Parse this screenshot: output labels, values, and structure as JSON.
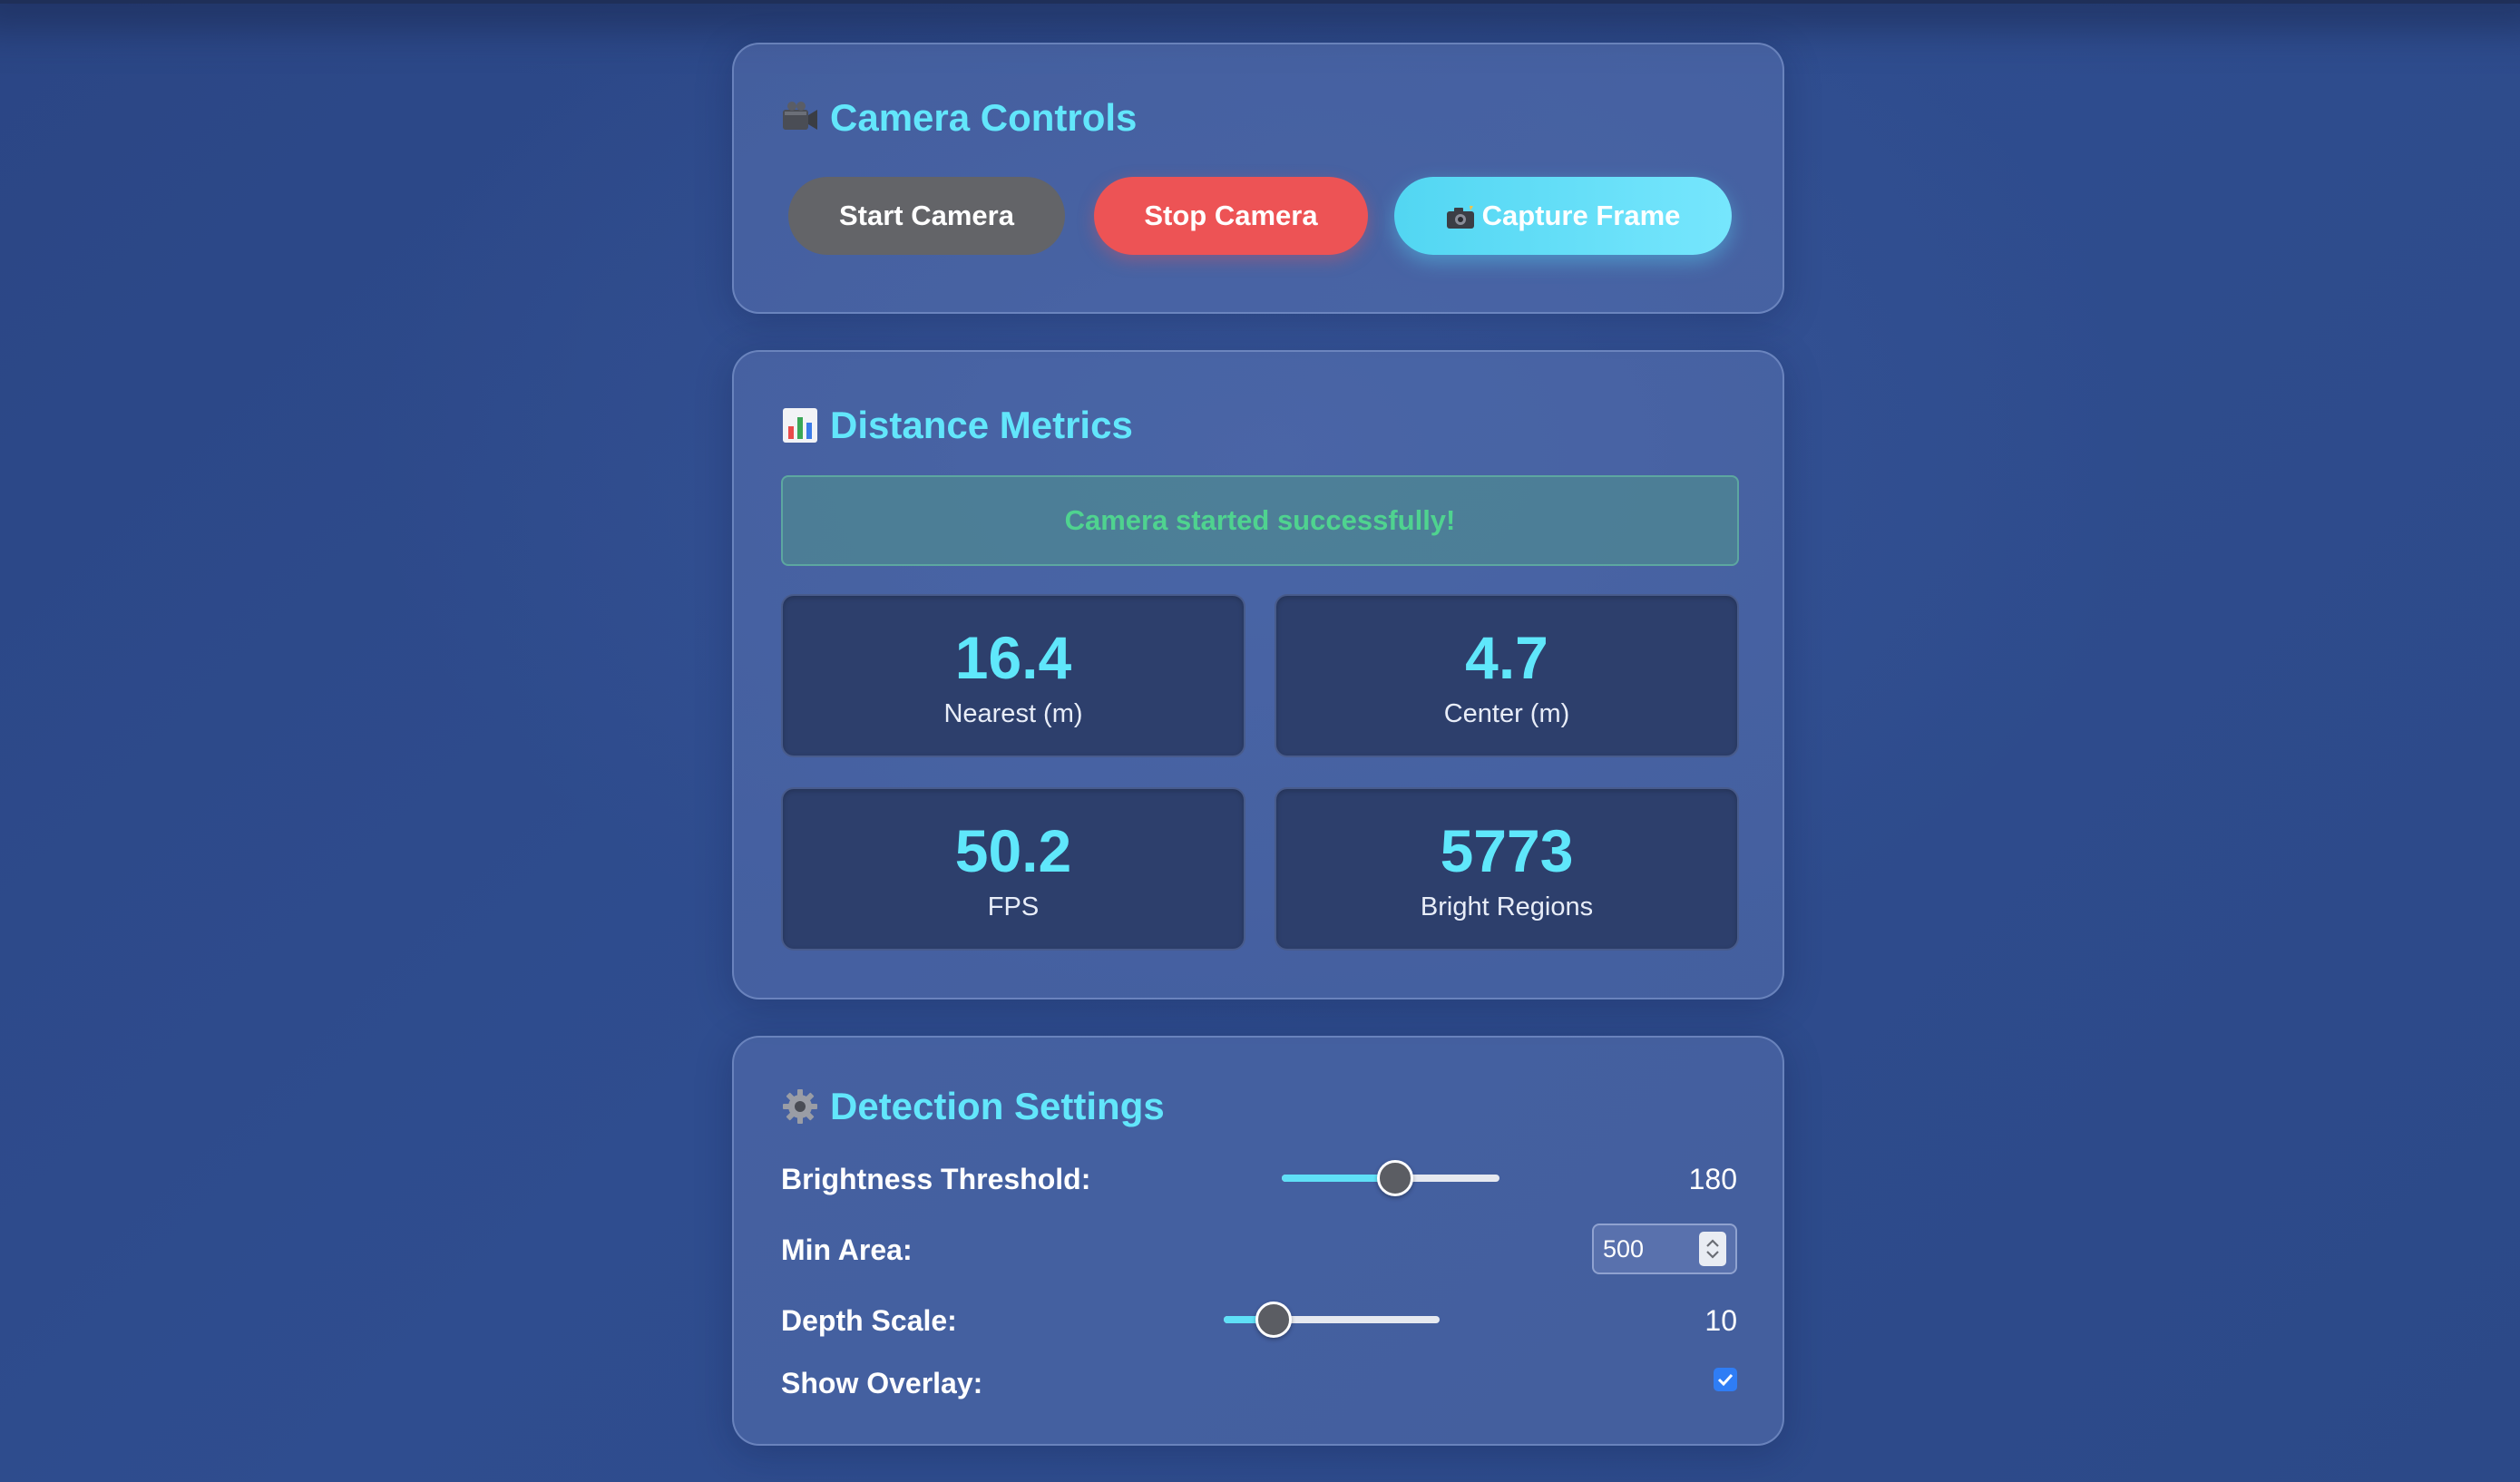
{
  "camera_controls": {
    "title": "Camera Controls",
    "icon": "video-camera-icon",
    "start_label": "Start Camera",
    "stop_label": "Stop Camera",
    "capture_label": "Capture Frame",
    "capture_icon": "camera-flash-icon"
  },
  "distance_metrics": {
    "title": "Distance Metrics",
    "icon": "bar-chart-icon",
    "status_message": "Camera started successfully!",
    "metrics": [
      {
        "value": "16.4",
        "label": "Nearest (m)"
      },
      {
        "value": "4.7",
        "label": "Center (m)"
      },
      {
        "value": "50.2",
        "label": "FPS"
      },
      {
        "value": "5773",
        "label": "Bright Regions"
      }
    ]
  },
  "detection_settings": {
    "title": "Detection Settings",
    "icon": "gear-icon",
    "brightness_threshold": {
      "label": "Brightness Threshold:",
      "value": "180",
      "fraction": 0.52
    },
    "min_area": {
      "label": "Min Area:",
      "value": "500"
    },
    "depth_scale": {
      "label": "Depth Scale:",
      "value": "10",
      "fraction": 0.23
    },
    "show_overlay": {
      "label": "Show Overlay:",
      "checked": true
    }
  },
  "colors": {
    "accent": "#62e6fb",
    "stop": "#ed5355",
    "start": "#636468",
    "success": "#4fd38f",
    "checkbox": "#2f7df5"
  }
}
